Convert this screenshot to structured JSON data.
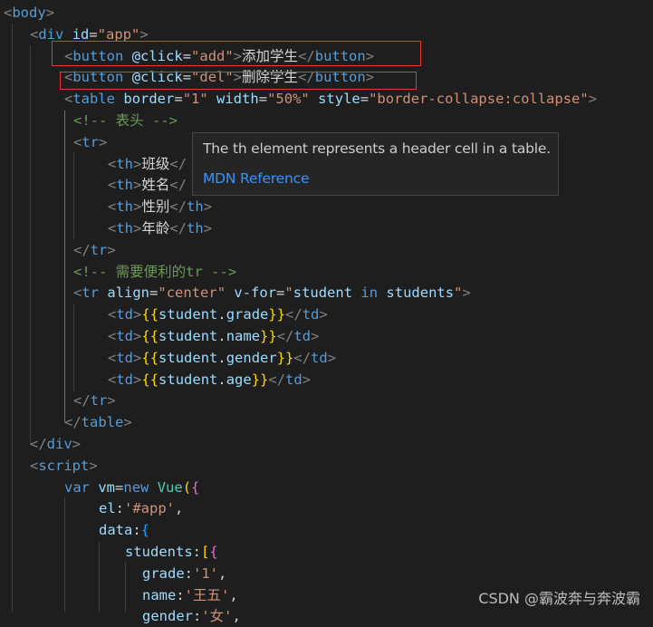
{
  "code_lines": [
    [
      [
        "tok-pun",
        "<"
      ],
      [
        "tok-tag",
        "body"
      ],
      [
        "tok-pun",
        ">"
      ]
    ],
    [
      [
        "tok-pun",
        "<"
      ],
      [
        "tok-tag",
        "div"
      ],
      [
        "tok-text",
        " "
      ],
      [
        "tok-attr",
        "id"
      ],
      [
        "tok-op",
        "="
      ],
      [
        "tok-str",
        "\"app\""
      ],
      [
        "tok-pun",
        ">"
      ]
    ],
    [
      [
        "tok-pun",
        "<"
      ],
      [
        "tok-tag",
        "button"
      ],
      [
        "tok-text",
        " "
      ],
      [
        "tok-attr",
        "@click"
      ],
      [
        "tok-op",
        "="
      ],
      [
        "tok-str",
        "\"add\""
      ],
      [
        "tok-pun",
        ">"
      ],
      [
        "tok-text",
        "添加学生"
      ],
      [
        "tok-pun",
        "</"
      ],
      [
        "tok-tag",
        "button"
      ],
      [
        "tok-pun",
        ">"
      ]
    ],
    [
      [
        "tok-pun",
        "<"
      ],
      [
        "tok-tag",
        "button"
      ],
      [
        "tok-text",
        " "
      ],
      [
        "tok-attr",
        "@click"
      ],
      [
        "tok-op",
        "="
      ],
      [
        "tok-str",
        "\"del\""
      ],
      [
        "tok-pun",
        ">"
      ],
      [
        "tok-text",
        "删除学生"
      ],
      [
        "tok-pun",
        "</"
      ],
      [
        "tok-tag",
        "button"
      ],
      [
        "tok-pun",
        ">"
      ]
    ],
    [
      [
        "tok-pun",
        "<"
      ],
      [
        "tok-tag",
        "table"
      ],
      [
        "tok-text",
        " "
      ],
      [
        "tok-attr",
        "border"
      ],
      [
        "tok-op",
        "="
      ],
      [
        "tok-str",
        "\"1\""
      ],
      [
        "tok-text",
        " "
      ],
      [
        "tok-attr",
        "width"
      ],
      [
        "tok-op",
        "="
      ],
      [
        "tok-str",
        "\"50%\""
      ],
      [
        "tok-text",
        " "
      ],
      [
        "tok-attr",
        "style"
      ],
      [
        "tok-op",
        "="
      ],
      [
        "tok-str",
        "\"border-collapse:"
      ],
      [
        "tok-str",
        "collapse\""
      ],
      [
        "tok-pun",
        ">"
      ]
    ],
    [
      [
        "tok-com",
        "<!-- 表头 -->"
      ]
    ],
    [
      [
        "tok-pun",
        "<"
      ],
      [
        "tok-tag",
        "tr"
      ],
      [
        "tok-pun",
        ">"
      ]
    ],
    [
      [
        "tok-pun",
        "<"
      ],
      [
        "tok-tag",
        "th"
      ],
      [
        "tok-pun",
        ">"
      ],
      [
        "tok-text",
        "班级"
      ],
      [
        "tok-pun",
        "</"
      ]
    ],
    [
      [
        "tok-pun",
        "<"
      ],
      [
        "tok-tag",
        "th"
      ],
      [
        "tok-pun",
        ">"
      ],
      [
        "tok-text",
        "姓名"
      ],
      [
        "tok-pun",
        "</"
      ]
    ],
    [
      [
        "tok-pun",
        "<"
      ],
      [
        "tok-tag",
        "th"
      ],
      [
        "tok-pun",
        ">"
      ],
      [
        "tok-text",
        "性别"
      ],
      [
        "tok-pun",
        "</"
      ],
      [
        "tok-tag",
        "th"
      ],
      [
        "tok-pun",
        ">"
      ]
    ],
    [
      [
        "tok-pun",
        "<"
      ],
      [
        "tok-tag",
        "th"
      ],
      [
        "tok-pun",
        ">"
      ],
      [
        "tok-text",
        "年龄"
      ],
      [
        "tok-pun",
        "</"
      ],
      [
        "tok-tag",
        "th"
      ],
      [
        "tok-pun",
        ">"
      ]
    ],
    [
      [
        "tok-pun",
        "</"
      ],
      [
        "tok-tag",
        "tr"
      ],
      [
        "tok-pun",
        ">"
      ]
    ],
    [
      [
        "tok-com",
        "<!-- 需要便利的tr -->"
      ]
    ],
    [
      [
        "tok-pun",
        "<"
      ],
      [
        "tok-tag",
        "tr"
      ],
      [
        "tok-text",
        " "
      ],
      [
        "tok-attr",
        "align"
      ],
      [
        "tok-op",
        "="
      ],
      [
        "tok-str",
        "\"center\""
      ],
      [
        "tok-text",
        " "
      ],
      [
        "tok-attr",
        "v-for"
      ],
      [
        "tok-op",
        "="
      ],
      [
        "tok-str",
        "\""
      ],
      [
        "tok-var",
        "student"
      ],
      [
        "tok-text",
        " "
      ],
      [
        "tok-kw",
        "in"
      ],
      [
        "tok-text",
        " "
      ],
      [
        "tok-var",
        "students"
      ],
      [
        "tok-str",
        "\""
      ],
      [
        "tok-pun",
        ">"
      ]
    ],
    [
      [
        "tok-pun",
        "<"
      ],
      [
        "tok-tag",
        "td"
      ],
      [
        "tok-pun",
        ">"
      ],
      [
        "tok-br1",
        "{{"
      ],
      [
        "tok-var",
        "student"
      ],
      [
        "tok-op",
        "."
      ],
      [
        "tok-var",
        "grade"
      ],
      [
        "tok-br1",
        "}}"
      ],
      [
        "tok-pun",
        "</"
      ],
      [
        "tok-tag",
        "td"
      ],
      [
        "tok-pun",
        ">"
      ]
    ],
    [
      [
        "tok-pun",
        "<"
      ],
      [
        "tok-tag",
        "td"
      ],
      [
        "tok-pun",
        ">"
      ],
      [
        "tok-br1",
        "{{"
      ],
      [
        "tok-var",
        "student"
      ],
      [
        "tok-op",
        "."
      ],
      [
        "tok-var",
        "name"
      ],
      [
        "tok-br1",
        "}}"
      ],
      [
        "tok-pun",
        "</"
      ],
      [
        "tok-tag",
        "td"
      ],
      [
        "tok-pun",
        ">"
      ]
    ],
    [
      [
        "tok-pun",
        "<"
      ],
      [
        "tok-tag",
        "td"
      ],
      [
        "tok-pun",
        ">"
      ],
      [
        "tok-br1",
        "{{"
      ],
      [
        "tok-var",
        "student"
      ],
      [
        "tok-op",
        "."
      ],
      [
        "tok-var",
        "gender"
      ],
      [
        "tok-br1",
        "}}"
      ],
      [
        "tok-pun",
        "</"
      ],
      [
        "tok-tag",
        "td"
      ],
      [
        "tok-pun",
        ">"
      ]
    ],
    [
      [
        "tok-pun",
        "<"
      ],
      [
        "tok-tag",
        "td"
      ],
      [
        "tok-pun",
        ">"
      ],
      [
        "tok-br1",
        "{{"
      ],
      [
        "tok-var",
        "student"
      ],
      [
        "tok-op",
        "."
      ],
      [
        "tok-var",
        "age"
      ],
      [
        "tok-br1",
        "}}"
      ],
      [
        "tok-pun",
        "</"
      ],
      [
        "tok-tag",
        "td"
      ],
      [
        "tok-pun",
        ">"
      ]
    ],
    [
      [
        "tok-pun",
        "</"
      ],
      [
        "tok-tag",
        "tr"
      ],
      [
        "tok-pun",
        ">"
      ]
    ],
    [
      [
        "tok-pun",
        "</"
      ],
      [
        "tok-tag",
        "table"
      ],
      [
        "tok-pun",
        ">"
      ]
    ],
    [
      [
        "tok-pun",
        "</"
      ],
      [
        "tok-tag",
        "div"
      ],
      [
        "tok-pun",
        ">"
      ]
    ],
    [
      [
        "tok-pun",
        "<"
      ],
      [
        "tok-tag",
        "script"
      ],
      [
        "tok-pun",
        ">"
      ]
    ],
    [
      [
        "tok-kw",
        "var"
      ],
      [
        "tok-text",
        " "
      ],
      [
        "tok-var",
        "vm"
      ],
      [
        "tok-op",
        "="
      ],
      [
        "tok-kw",
        "new"
      ],
      [
        "tok-text",
        " "
      ],
      [
        "tok-cls",
        "Vue"
      ],
      [
        "tok-br1",
        "("
      ],
      [
        "tok-br2",
        "{"
      ]
    ],
    [
      [
        "tok-var",
        "el"
      ],
      [
        "tok-op",
        ":"
      ],
      [
        "tok-str",
        "'#app'"
      ],
      [
        "tok-op",
        ","
      ]
    ],
    [
      [
        "tok-var",
        "data"
      ],
      [
        "tok-op",
        ":"
      ],
      [
        "tok-br3",
        "{"
      ]
    ],
    [
      [
        "tok-var",
        "students"
      ],
      [
        "tok-op",
        ":"
      ],
      [
        "tok-br1",
        "["
      ],
      [
        "tok-br2",
        "{"
      ]
    ],
    [
      [
        "tok-var",
        "grade"
      ],
      [
        "tok-op",
        ":"
      ],
      [
        "tok-str",
        "'1'"
      ],
      [
        "tok-op",
        ","
      ]
    ],
    [
      [
        "tok-var",
        "name"
      ],
      [
        "tok-op",
        ":"
      ],
      [
        "tok-str",
        "'王五'"
      ],
      [
        "tok-op",
        ","
      ]
    ],
    [
      [
        "tok-var",
        "gender"
      ],
      [
        "tok-op",
        ":"
      ],
      [
        "tok-str",
        "'女'"
      ],
      [
        "tok-op",
        ","
      ]
    ]
  ],
  "tooltip": {
    "description": "The th element represents a header cell in a table.",
    "link": "MDN Reference"
  },
  "watermark": "CSDN @霸波奔与奔波霸",
  "annotation_color": "#e8382f"
}
